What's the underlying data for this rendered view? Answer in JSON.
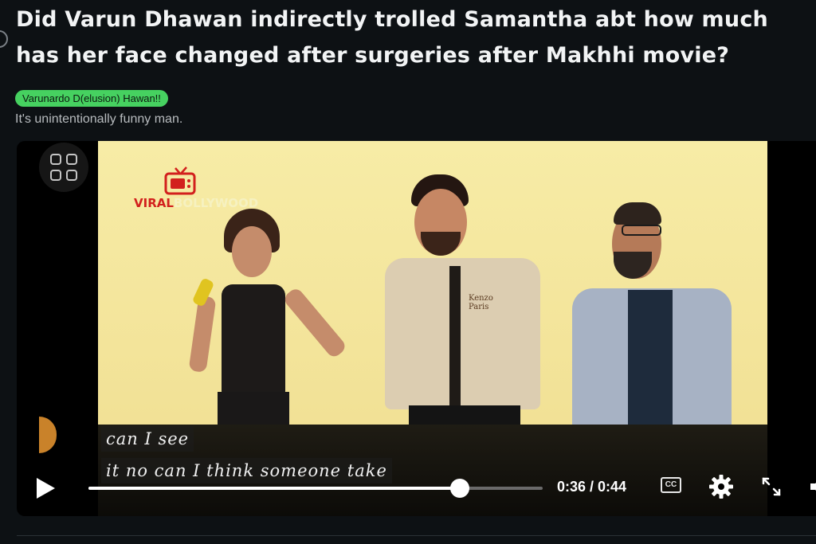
{
  "post": {
    "title": "Did Varun Dhawan indirectly trolled Samantha abt how much has her face changed after surgeries after Makhhi movie?",
    "flair": "Varunardo D(elusion) Hawan!!",
    "body": "It's unintentionally funny man."
  },
  "video": {
    "watermark_a": "VIRAL",
    "watermark_b": "BOLLYWOOD",
    "captions": [
      "can I see",
      "it no can I think someone take"
    ],
    "shirt_text": "Kenzo Paris",
    "controls": {
      "current_time": "0:36",
      "duration": "0:44",
      "time_text": "0:36 / 0:44",
      "progress_fraction": 0.818,
      "cc_label": "CC",
      "icons": [
        "play-icon",
        "closed-captions-icon",
        "settings-gear-icon",
        "fullscreen-expand-icon",
        "volume-icon",
        "grid-menu-icon"
      ]
    }
  },
  "colors": {
    "background": "#0d1114",
    "flair_bg": "#46d160",
    "logo_red": "#d2201d",
    "video_bg": "#f3e49a"
  }
}
